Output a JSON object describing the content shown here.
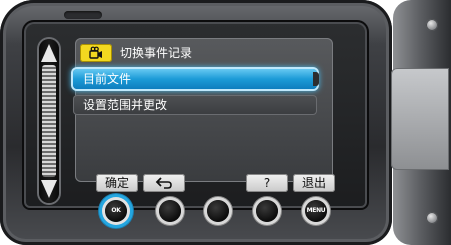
{
  "menu": {
    "title": "切换事件记录",
    "items": [
      {
        "label": "目前文件",
        "selected": true
      },
      {
        "label": "设置范围并更改",
        "selected": false
      }
    ]
  },
  "softkeys": {
    "ok": "确定",
    "back_icon": "return-arrow-icon",
    "help": "?",
    "exit": "退出"
  },
  "buttons": {
    "ok_label": "OK",
    "menu_label": "MENU"
  },
  "colors": {
    "selection_blue": "#1c9bd7",
    "ok_ring": "#24a6e0",
    "mode_icon_yellow": "#f2d820"
  }
}
